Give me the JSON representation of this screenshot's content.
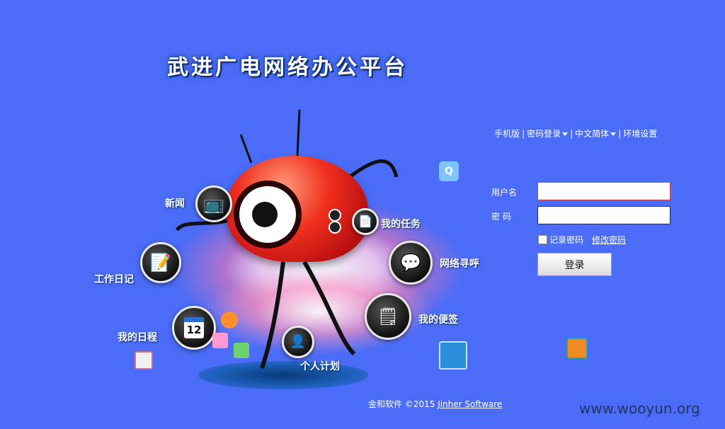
{
  "app": {
    "title": "武进广电网络办公平台"
  },
  "top_links": {
    "mobile": "手机版",
    "password_login": "密码登录",
    "language": "中文简体",
    "env_settings": "环境设置"
  },
  "login": {
    "username_label": "用户名",
    "password_label": "密 码",
    "username_value": "",
    "password_value": "",
    "remember_label": "记录密码",
    "change_password_label": "修改密码",
    "login_button": "登录"
  },
  "features": {
    "news": "新闻",
    "my_tasks": "我的任务",
    "work_diary": "工作日记",
    "network_pager": "网络寻呼",
    "my_notes": "我的便签",
    "my_schedule": "我的日程",
    "personal_plan": "个人计划"
  },
  "icons": {
    "qq": "qq-icon",
    "calendar_day": "12"
  },
  "footer": {
    "company": "金和软件 ©2015",
    "link": "Jinher Software"
  },
  "watermark": "www.wooyun.org",
  "colors": {
    "background": "#4a6cf6",
    "mascot": "#e0261c"
  }
}
